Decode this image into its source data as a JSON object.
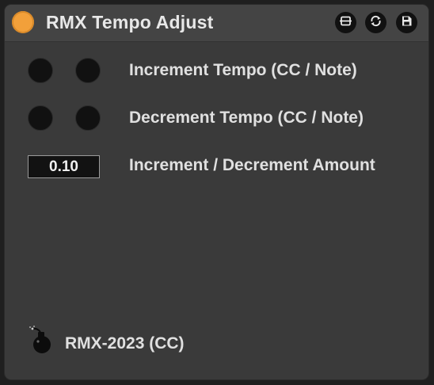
{
  "device": {
    "title": "RMX Tempo Adjust",
    "power_color": "#f2a03a",
    "header_buttons": [
      "resize-icon",
      "refresh-icon",
      "save-icon"
    ]
  },
  "rows": {
    "increment": {
      "label": "Increment Tempo (CC / Note)"
    },
    "decrement": {
      "label": "Decrement Tempo (CC / Note)"
    },
    "amount": {
      "label": "Increment / Decrement Amount",
      "value": "0.10"
    }
  },
  "footer": {
    "label": "RMX-2023 (CC)",
    "icon": "bomb-icon"
  }
}
